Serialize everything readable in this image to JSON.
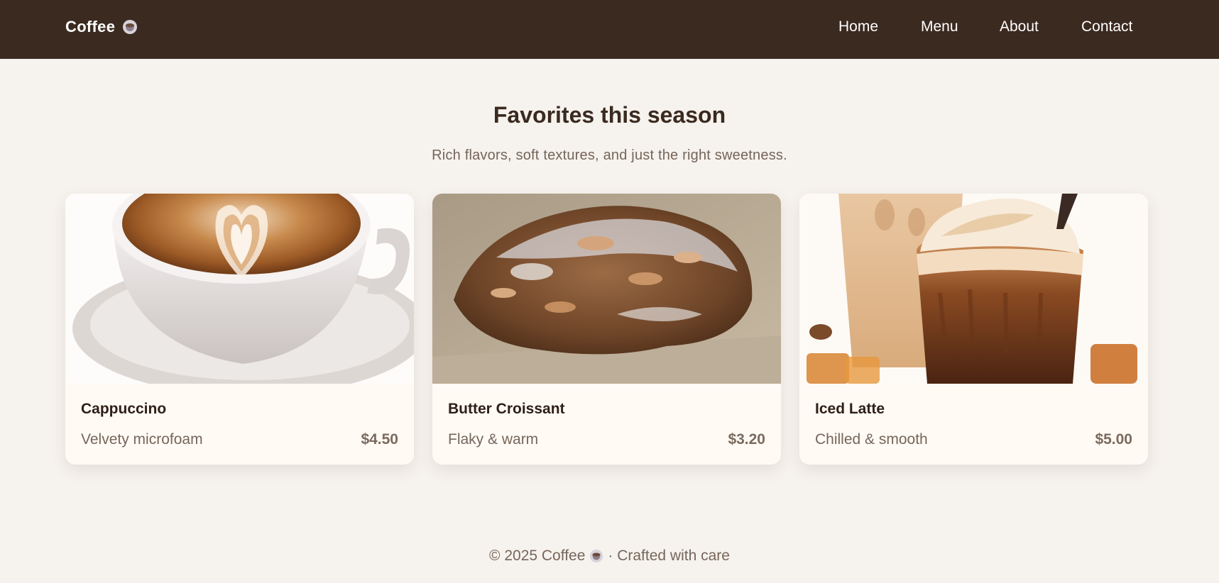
{
  "nav": {
    "brand": "Coffee",
    "brand_icon": "coffee-cup-icon",
    "links": [
      "Home",
      "Menu",
      "About",
      "Contact"
    ]
  },
  "hero": {
    "title": "Favorites this season",
    "subtitle": "Rich flavors, soft textures, and just the right sweetness."
  },
  "products": [
    {
      "name": "Cappuccino",
      "desc": "Velvety microfoam",
      "price": "$4.50",
      "image": "cappuccino-latte-art-photo"
    },
    {
      "name": "Butter Croissant",
      "desc": "Flaky & warm",
      "price": "$3.20",
      "image": "almond-croissant-photo"
    },
    {
      "name": "Iced Latte",
      "desc": "Chilled & smooth",
      "price": "$5.00",
      "image": "iced-latte-glasses-photo"
    }
  ],
  "footer": {
    "copyright": "© 2025 Coffee",
    "tagline": "· Crafted with care"
  },
  "colors": {
    "navbar": "#3b2a20",
    "background": "#f6f2ed",
    "card": "#fffaf4",
    "heading": "#3a2a1f",
    "muted": "#76665b"
  }
}
